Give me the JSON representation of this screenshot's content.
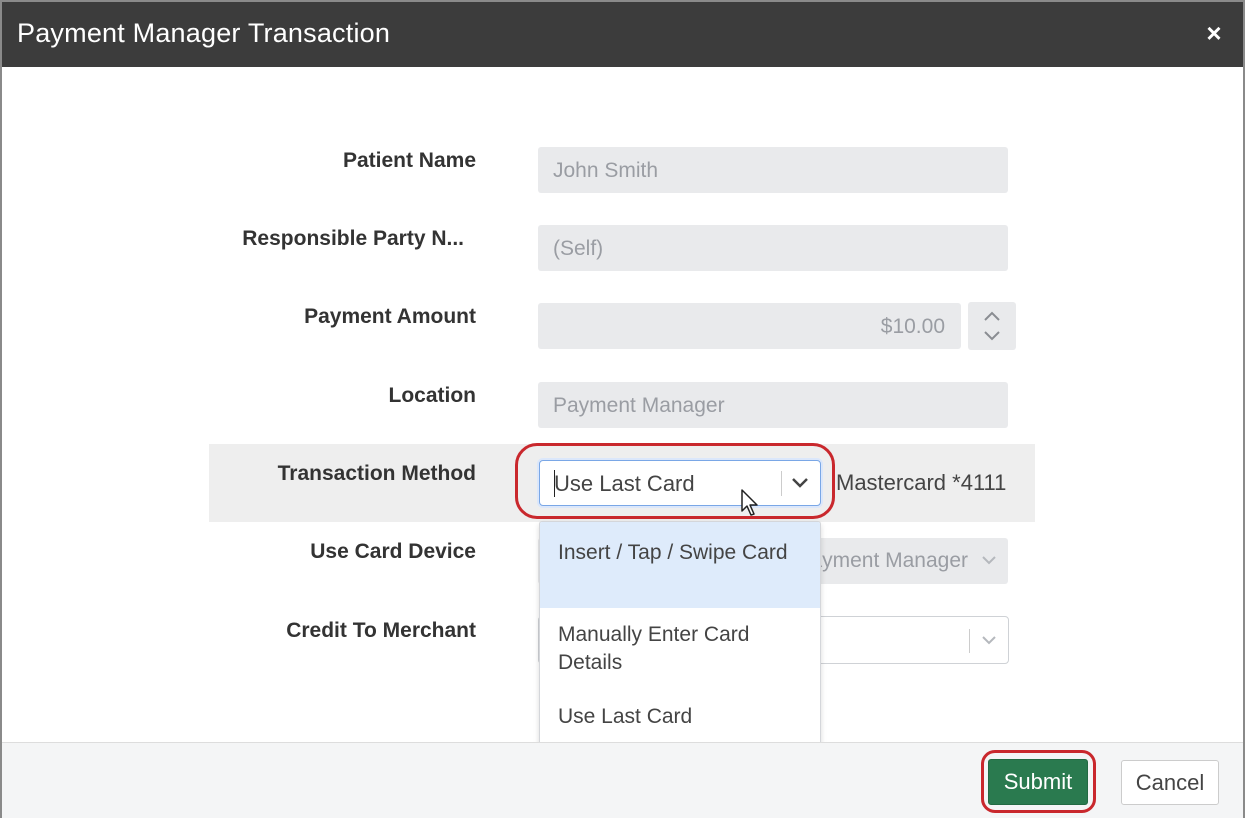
{
  "dialog": {
    "title": "Payment Manager Transaction",
    "close_label": "×"
  },
  "form": {
    "patient_name": {
      "label": "Patient Name",
      "value": "John Smith"
    },
    "responsible_party": {
      "label": "Responsible Party N...",
      "value": "(Self)"
    },
    "payment_amount": {
      "label": "Payment Amount",
      "value": "$10.00"
    },
    "location": {
      "label": "Location",
      "value": "Payment Manager"
    },
    "transaction_method": {
      "label": "Transaction Method",
      "value": "Use Last Card",
      "card_info": "Mastercard *4111",
      "options": [
        {
          "label": "Insert / Tap / Swipe Card",
          "highlighted": true
        },
        {
          "label": "Manually Enter Card Details",
          "highlighted": false
        },
        {
          "label": "Use Last Card",
          "highlighted": false
        }
      ]
    },
    "use_card_device": {
      "label": "Use Card Device",
      "value": "Payment Manager"
    },
    "credit_to_merchant": {
      "label": "Credit To Merchant",
      "value": ""
    }
  },
  "footer": {
    "submit_label": "Submit",
    "cancel_label": "Cancel"
  },
  "colors": {
    "titlebar": "#3c3c3c",
    "submit": "#2a7a4f",
    "highlight_ring": "#c9282d",
    "option_hover": "#deebfb"
  }
}
